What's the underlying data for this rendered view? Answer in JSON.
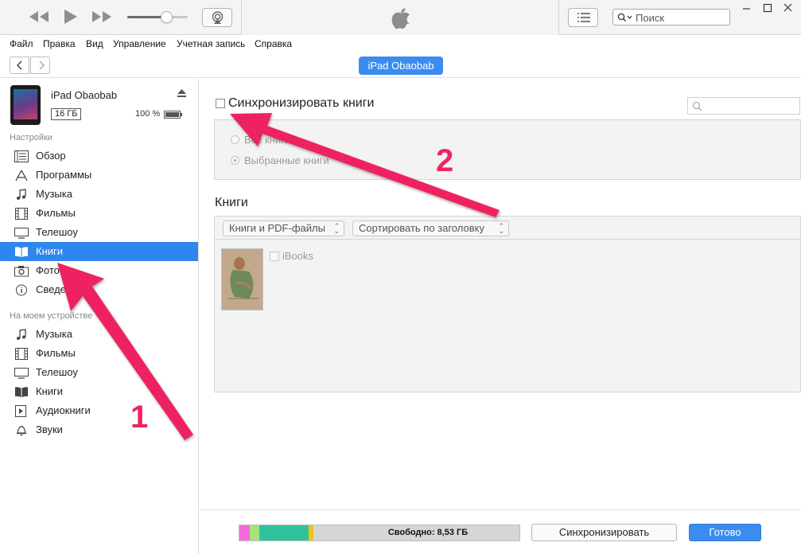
{
  "titlebar": {
    "search_placeholder": "Поиск",
    "volume_level": 0.65
  },
  "menu": [
    "Файл",
    "Правка",
    "Вид",
    "Управление",
    "Учетная запись",
    "Справка"
  ],
  "nav": {
    "device_pill": "iPad Obaobab"
  },
  "device": {
    "name": "iPad Obaobab",
    "capacity": "16 ГБ",
    "battery": "100 %"
  },
  "sidebar": {
    "settings_header": "Настройки",
    "settings_items": [
      {
        "label": "Обзор",
        "icon": "summary-icon"
      },
      {
        "label": "Программы",
        "icon": "apps-icon"
      },
      {
        "label": "Музыка",
        "icon": "music-note-icon"
      },
      {
        "label": "Фильмы",
        "icon": "film-icon"
      },
      {
        "label": "Телешоу",
        "icon": "tv-icon"
      },
      {
        "label": "Книги",
        "icon": "book-icon",
        "selected": true
      },
      {
        "label": "Фото",
        "icon": "camera-icon"
      },
      {
        "label": "Сведения",
        "icon": "info-icon"
      }
    ],
    "device_header": "На моем устройстве",
    "device_items": [
      {
        "label": "Музыка",
        "icon": "music-note-icon"
      },
      {
        "label": "Фильмы",
        "icon": "film-icon"
      },
      {
        "label": "Телешоу",
        "icon": "tv-icon"
      },
      {
        "label": "Книги",
        "icon": "book-icon"
      },
      {
        "label": "Аудиокниги",
        "icon": "audiobook-icon"
      },
      {
        "label": "Звуки",
        "icon": "bell-icon"
      }
    ]
  },
  "main": {
    "sync_label": "Синхронизировать книги",
    "radio_all": "Все книги",
    "radio_selected": "Выбранные книги",
    "books_heading": "Книги",
    "filter_dropdown": "Книги и PDF-файлы",
    "sort_dropdown": "Сортировать по заголовку",
    "book_title": "iBooks"
  },
  "footer": {
    "free_label": "Свободно: 8,53 ГБ",
    "sync_button": "Синхронизировать",
    "done_button": "Готово",
    "storage_segments": [
      {
        "name": "pink",
        "color": "#f26bd9",
        "fraction": 0.037
      },
      {
        "name": "light-green",
        "color": "#a9e07a",
        "fraction": 0.034
      },
      {
        "name": "teal",
        "color": "#2fc29b",
        "fraction": 0.176
      },
      {
        "name": "yellow",
        "color": "#f2c21a",
        "fraction": 0.017
      },
      {
        "name": "free",
        "color": "#d6d6d6",
        "fraction": 0.736
      }
    ]
  },
  "annotations": {
    "marker_1": "1",
    "marker_2": "2",
    "arrow_color": "#ee2460"
  }
}
